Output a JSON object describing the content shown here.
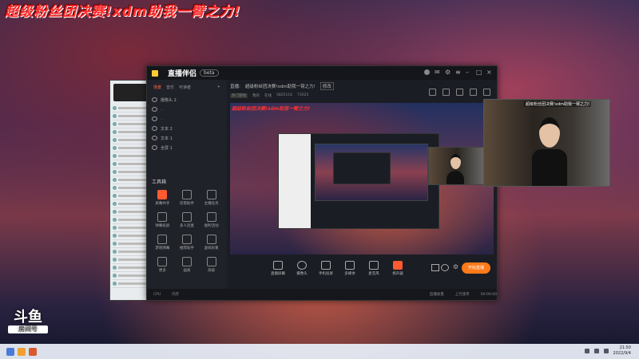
{
  "banner": "超级粉丝团决赛!xdm助我一臂之力!",
  "watermark": {
    "logo": "斗鱼",
    "sub": "房间号"
  },
  "app": {
    "title": "直播伴侣",
    "version_badge": "beta",
    "sidebar": {
      "tabs": [
        "场景",
        "音乐",
        "可读者"
      ],
      "scenes": [
        "摄像头 2",
        "文本 2",
        "文本 1",
        "全屏 1"
      ],
      "tools_title": "工具箱",
      "tools": [
        "屏幕共享",
        "房管助手",
        "主播任务",
        "弹幕投屏",
        "多人连麦",
        "福利活动",
        "游戏弹幕",
        "推荐助手",
        "虚拟形象",
        "更多",
        "画质",
        "高级"
      ],
      "footer": "主播直播中"
    },
    "header": {
      "label": "直播:",
      "stream_title": "超级粉丝团决赛!xdm助我一臂之力!",
      "edit": "修改",
      "sub": [
        "热门游戏",
        "我的",
        "在线",
        "5825114",
        "73025"
      ]
    },
    "preview_banner": "超级粉丝团决赛!xdm助我一臂之力!",
    "controls": [
      "直播屏幕",
      "摄像头",
      "手机投屏",
      "多媒体",
      "麦克风",
      "扬声器"
    ],
    "go_live": "开始直播",
    "status": [
      "CPU",
      "内存",
      "直播质量",
      "上行速率",
      "00:00:00"
    ]
  },
  "cam_overlay_text": "超级粉丝团决赛!xdm助我一臂之力!",
  "taskbar": {
    "time": "21:50",
    "date": "2022/9/4"
  }
}
